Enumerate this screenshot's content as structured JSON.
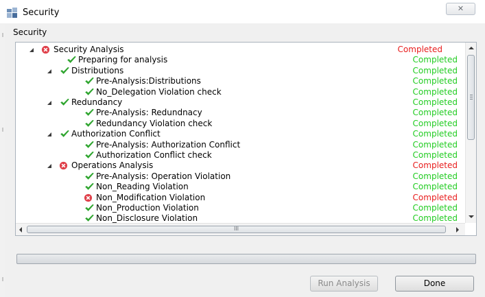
{
  "window": {
    "title": "Security",
    "close_symbol": "✕"
  },
  "section": {
    "label": "Security"
  },
  "tree": {
    "rows": [
      {
        "indent": 0,
        "expandable": true,
        "icon": "error-icon",
        "label": "Security Analysis",
        "status": "Completed",
        "state": "error"
      },
      {
        "indent": 1,
        "expandable": false,
        "icon": "check-icon",
        "label": "Preparing for analysis",
        "status": "Completed",
        "state": "ok"
      },
      {
        "indent": 1,
        "expandable": true,
        "icon": "check-icon",
        "label": "Distributions",
        "status": "Completed",
        "state": "ok"
      },
      {
        "indent": 2,
        "expandable": false,
        "icon": "check-icon",
        "label": "Pre-Analysis:Distributions",
        "status": "Completed",
        "state": "ok"
      },
      {
        "indent": 2,
        "expandable": false,
        "icon": "check-icon",
        "label": "No_Delegation Violation check",
        "status": "Completed",
        "state": "ok"
      },
      {
        "indent": 1,
        "expandable": true,
        "icon": "check-icon",
        "label": "Redundancy",
        "status": "Completed",
        "state": "ok"
      },
      {
        "indent": 2,
        "expandable": false,
        "icon": "check-icon",
        "label": "Pre-Analysis: Redundnacy",
        "status": "Completed",
        "state": "ok"
      },
      {
        "indent": 2,
        "expandable": false,
        "icon": "check-icon",
        "label": "Redundancy Violation check",
        "status": "Completed",
        "state": "ok"
      },
      {
        "indent": 1,
        "expandable": true,
        "icon": "check-icon",
        "label": "Authorization Conflict",
        "status": "Completed",
        "state": "ok"
      },
      {
        "indent": 2,
        "expandable": false,
        "icon": "check-icon",
        "label": "Pre-Analysis: Authorization Conflict",
        "status": "Completed",
        "state": "ok"
      },
      {
        "indent": 2,
        "expandable": false,
        "icon": "check-icon",
        "label": "Authorization Conflict check",
        "status": "Completed",
        "state": "ok"
      },
      {
        "indent": 1,
        "expandable": true,
        "icon": "error-icon",
        "label": "Operations Analysis",
        "status": "Completed",
        "state": "error"
      },
      {
        "indent": 2,
        "expandable": false,
        "icon": "check-icon",
        "label": "Pre-Analysis: Operation Violation",
        "status": "Completed",
        "state": "ok"
      },
      {
        "indent": 2,
        "expandable": false,
        "icon": "check-icon",
        "label": "Non_Reading Violation",
        "status": "Completed",
        "state": "ok"
      },
      {
        "indent": 2,
        "expandable": false,
        "icon": "error-icon",
        "label": "Non_Modification Violation",
        "status": "Completed",
        "state": "error"
      },
      {
        "indent": 2,
        "expandable": false,
        "icon": "check-icon",
        "label": "Non_Production Violation",
        "status": "Completed",
        "state": "ok"
      },
      {
        "indent": 2,
        "expandable": false,
        "icon": "check-icon",
        "label": "Non_Disclosure Violation",
        "status": "Completed",
        "state": "ok"
      }
    ],
    "hscroll_grip": "III"
  },
  "progress": {
    "value": 0
  },
  "buttons": {
    "run_analysis": "Run Analysis",
    "done": "Done"
  },
  "colors": {
    "ok": "#22cc22",
    "error": "#e81c1c",
    "check": "#2fa52f",
    "error_icon": "#e0404a"
  }
}
